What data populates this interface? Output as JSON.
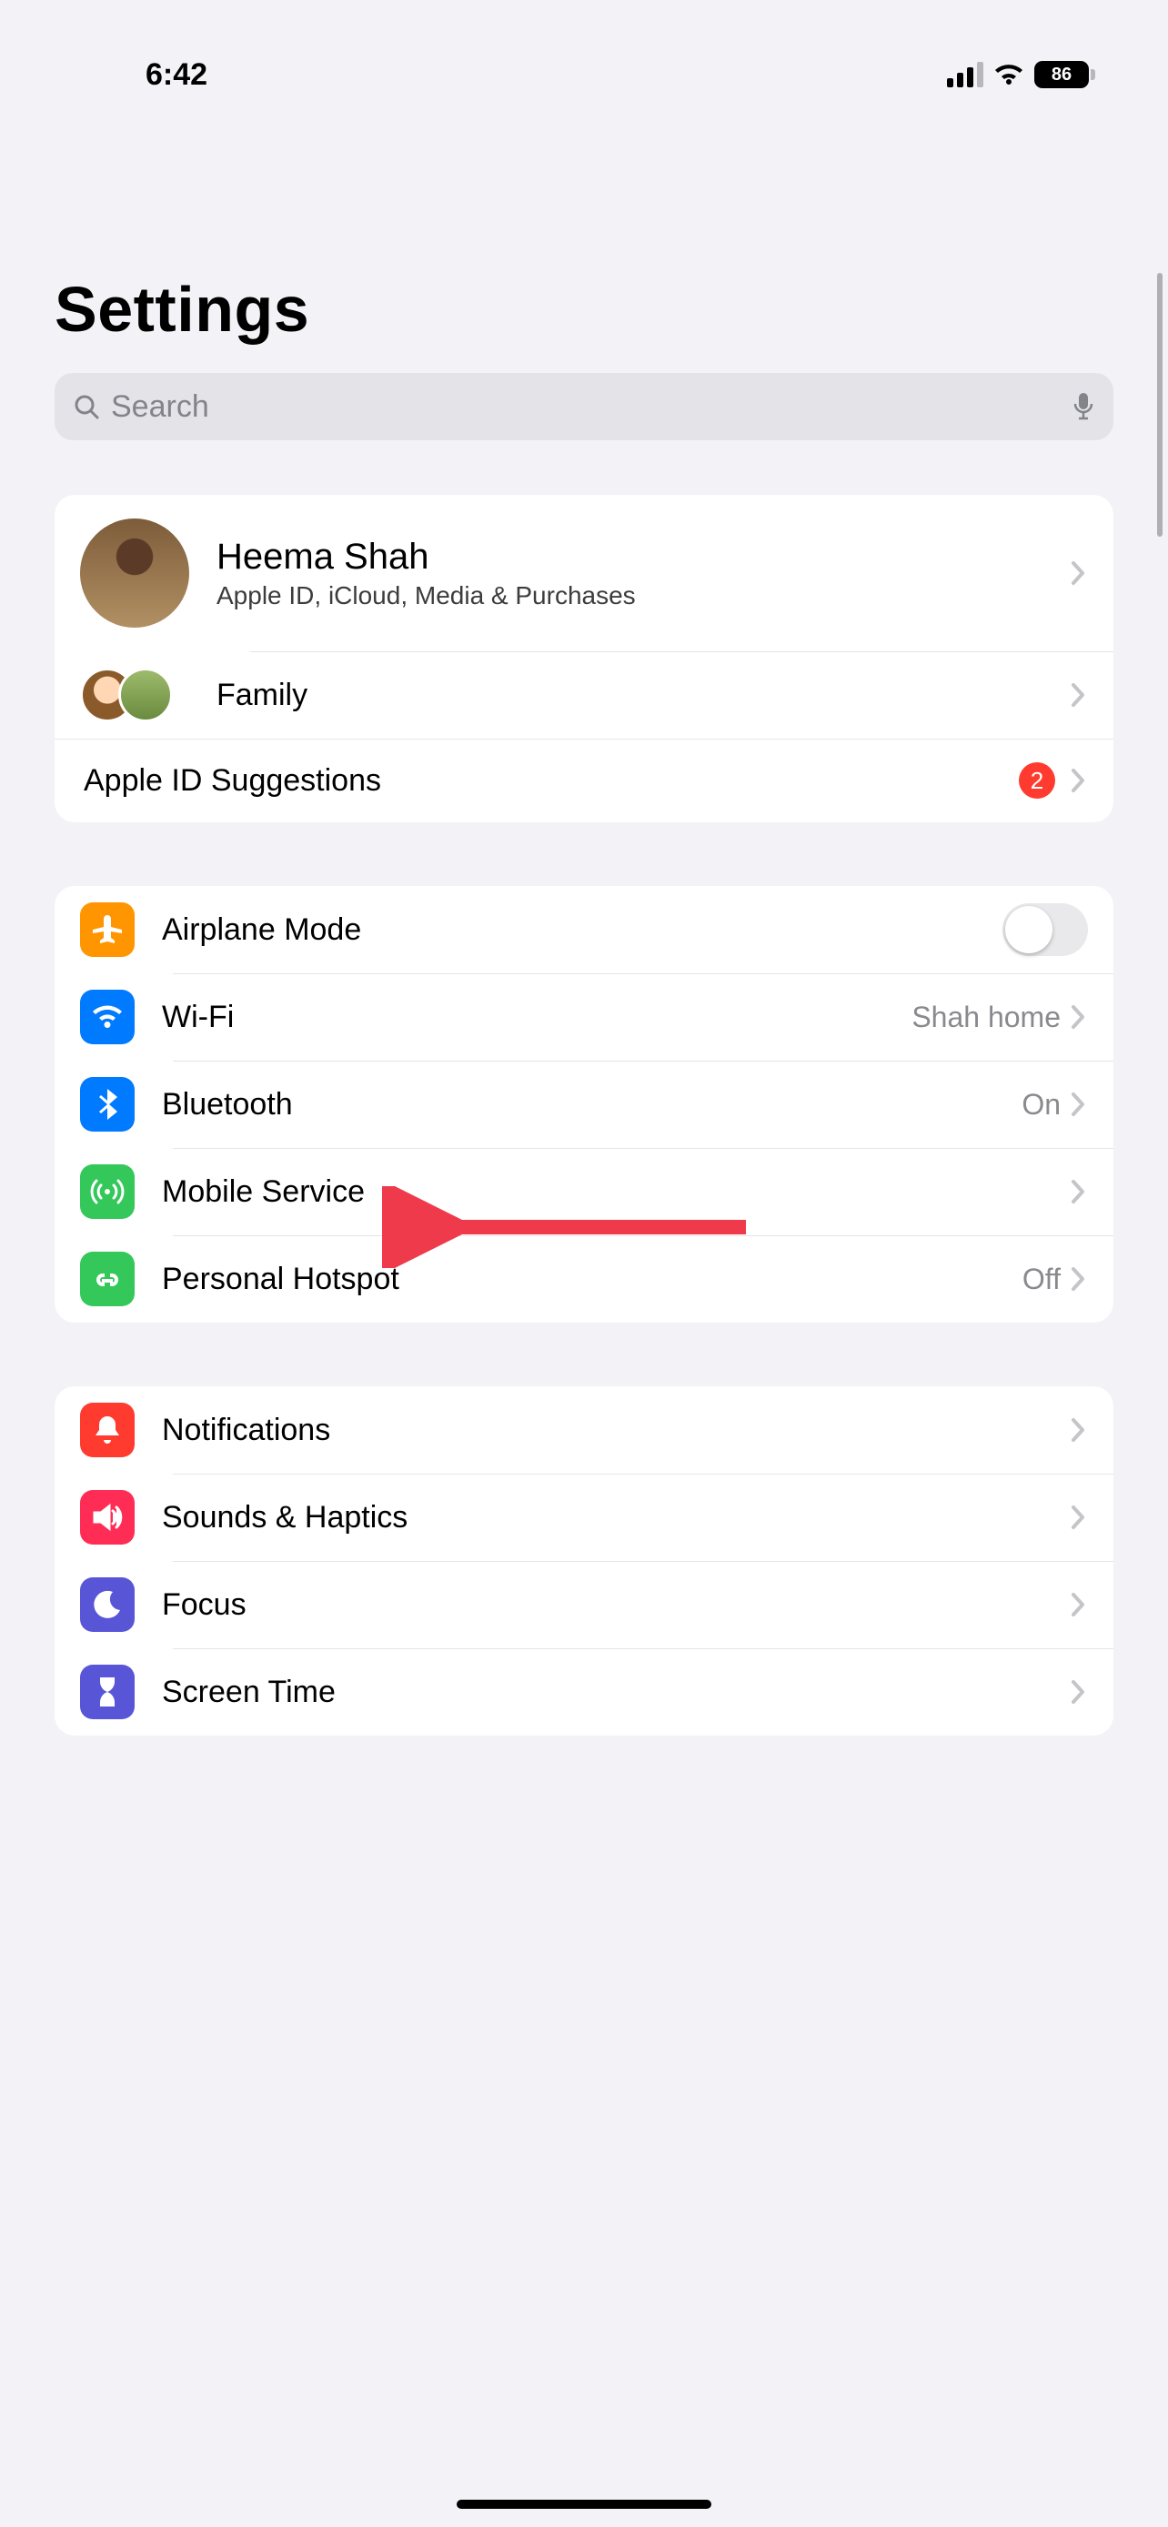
{
  "status": {
    "time": "6:42",
    "battery": "86"
  },
  "title": "Settings",
  "search": {
    "placeholder": "Search"
  },
  "profile": {
    "name": "Heema Shah",
    "subtitle": "Apple ID, iCloud, Media & Purchases",
    "family_label": "Family",
    "suggestions_label": "Apple ID Suggestions",
    "suggestions_badge": "2"
  },
  "connectivity": {
    "airplane": {
      "label": "Airplane Mode"
    },
    "wifi": {
      "label": "Wi-Fi",
      "detail": "Shah home"
    },
    "bluetooth": {
      "label": "Bluetooth",
      "detail": "On"
    },
    "mobile": {
      "label": "Mobile Service"
    },
    "hotspot": {
      "label": "Personal Hotspot",
      "detail": "Off"
    }
  },
  "prefs": {
    "notifications": {
      "label": "Notifications"
    },
    "sounds": {
      "label": "Sounds & Haptics"
    },
    "focus": {
      "label": "Focus"
    },
    "screentime": {
      "label": "Screen Time"
    }
  },
  "annotation": {
    "arrow_target": "mobile-service"
  }
}
